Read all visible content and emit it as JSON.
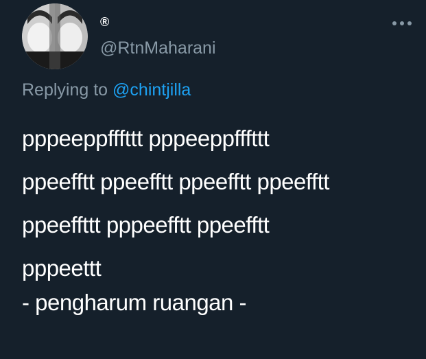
{
  "author": {
    "display_name": "®",
    "handle": "@RtnMaharani"
  },
  "reply": {
    "prefix": "Replying to",
    "mention": "@chintjilla"
  },
  "tweet": {
    "lines": [
      "pppeeppfffttt pppeeppfffttt",
      "ppeefftt ppeefftt ppeefftt ppeefftt",
      "ppeeffttt pppeefftt ppeefftt",
      "pppeettt"
    ],
    "signature": "- pengharum ruangan -"
  },
  "icons": {
    "more": "more-options-icon",
    "avatar": "avatar-image"
  },
  "colors": {
    "background": "#15202b",
    "secondary_text": "#8899a6",
    "accent": "#1da1f2"
  }
}
